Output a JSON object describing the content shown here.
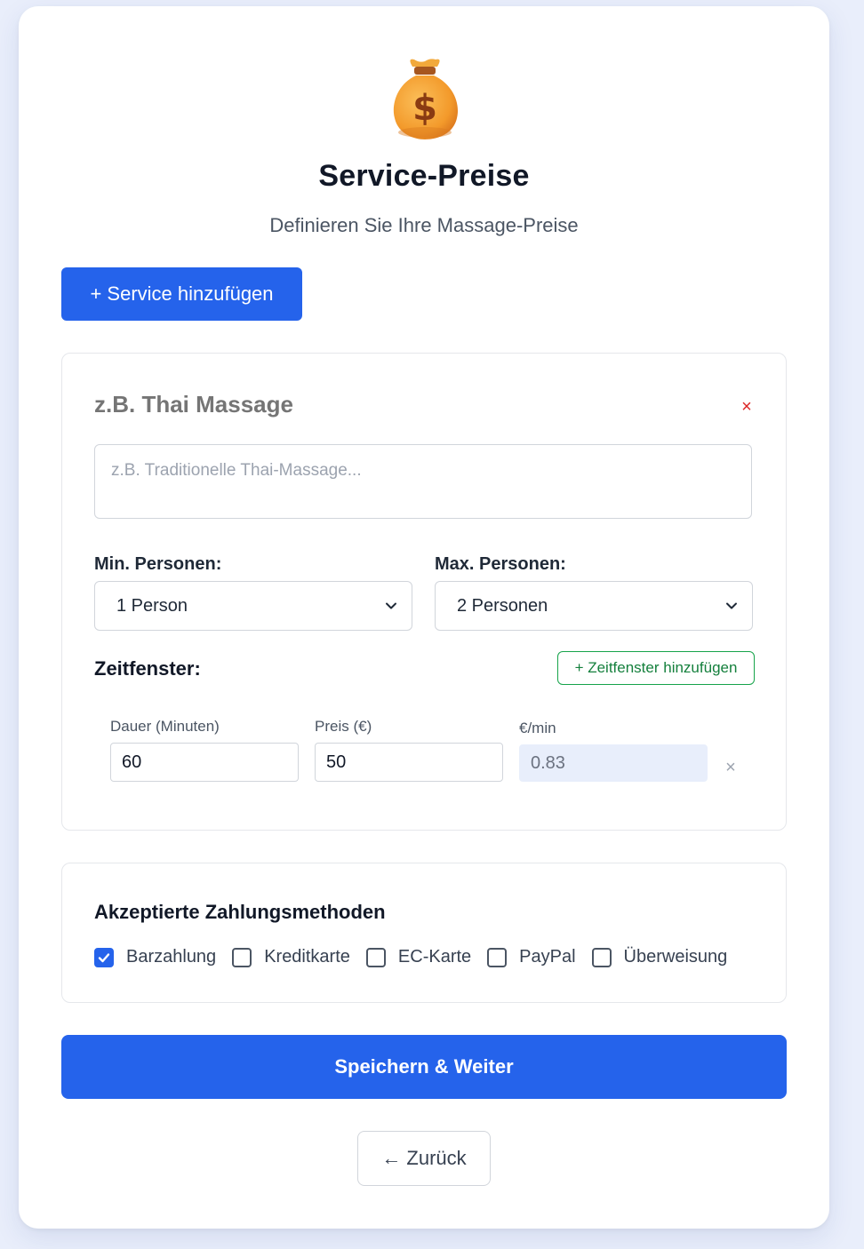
{
  "header": {
    "icon": "money-bag-icon",
    "title": "Service-Preise",
    "subtitle": "Definieren Sie Ihre Massage-Preise"
  },
  "add_service_label": "+ Service hinzufügen",
  "service": {
    "name_placeholder": "z.B. Thai Massage",
    "remove_symbol": "×",
    "description_placeholder": "z.B. Traditionelle Thai-Massage...",
    "min_persons_label": "Min. Personen:",
    "min_persons_value": "1 Person",
    "max_persons_label": "Max. Personen:",
    "max_persons_value": "2 Personen",
    "timeslots_label": "Zeitfenster:",
    "add_timeslot_label": "+ Zeitfenster hinzufügen",
    "timeslot": {
      "duration_label": "Dauer (Minuten)",
      "duration_value": "60",
      "price_label": "Preis (€)",
      "price_value": "50",
      "per_min_label": "€/min",
      "per_min_value": "0.83",
      "remove_symbol": "×"
    }
  },
  "payment": {
    "title": "Akzeptierte Zahlungsmethoden",
    "methods": [
      {
        "label": "Barzahlung",
        "checked": true
      },
      {
        "label": "Kreditkarte",
        "checked": false
      },
      {
        "label": "EC-Karte",
        "checked": false
      },
      {
        "label": "PayPal",
        "checked": false
      },
      {
        "label": "Überweisung",
        "checked": false
      }
    ]
  },
  "save_label": "Speichern & Weiter",
  "back_label": "← Zurück",
  "colors": {
    "primary": "#2563eb",
    "success": "#16a34a",
    "danger": "#dc2626",
    "background": "#e9eefb"
  }
}
